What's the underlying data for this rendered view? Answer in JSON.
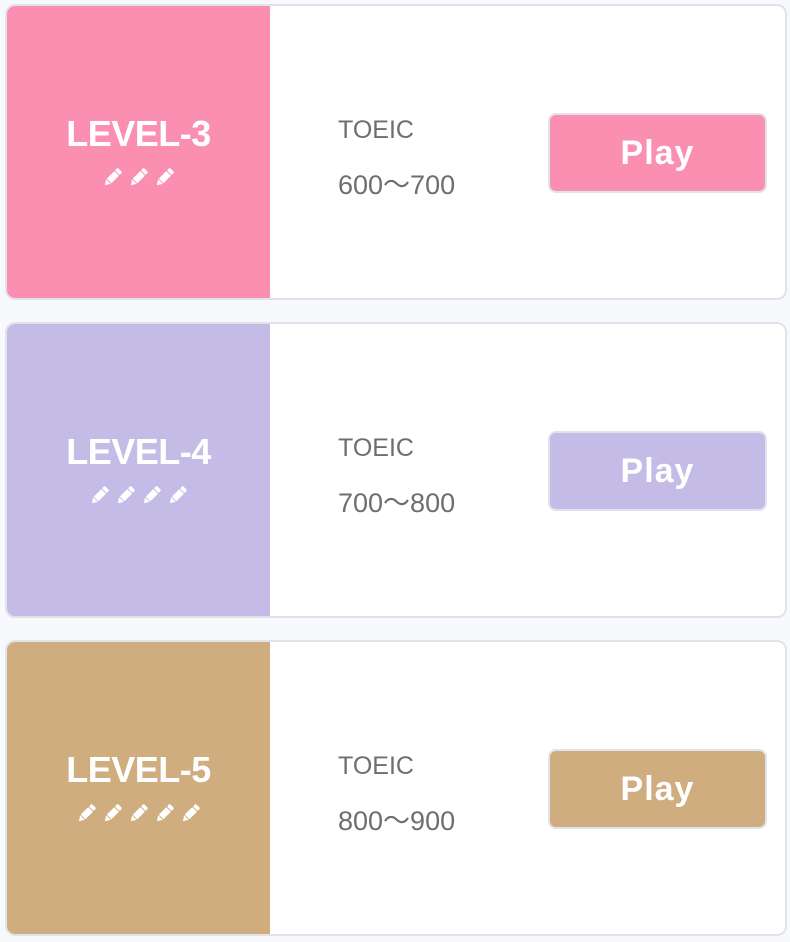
{
  "levels": [
    {
      "title": "LEVEL-3",
      "pencil_icon": "pencil-icon",
      "pencil_count": 3,
      "exam_name": "TOEIC",
      "score_range": "600〜700",
      "play_label": "Play",
      "color": "#fb8fb1"
    },
    {
      "title": "LEVEL-4",
      "pencil_icon": "pencil-icon",
      "pencil_count": 4,
      "exam_name": "TOEIC",
      "score_range": "700〜800",
      "play_label": "Play",
      "color": "#c4bce6"
    },
    {
      "title": "LEVEL-5",
      "pencil_icon": "pencil-icon",
      "pencil_count": 5,
      "exam_name": "TOEIC",
      "score_range": "800〜900",
      "play_label": "Play",
      "color": "#cfad7f"
    }
  ]
}
